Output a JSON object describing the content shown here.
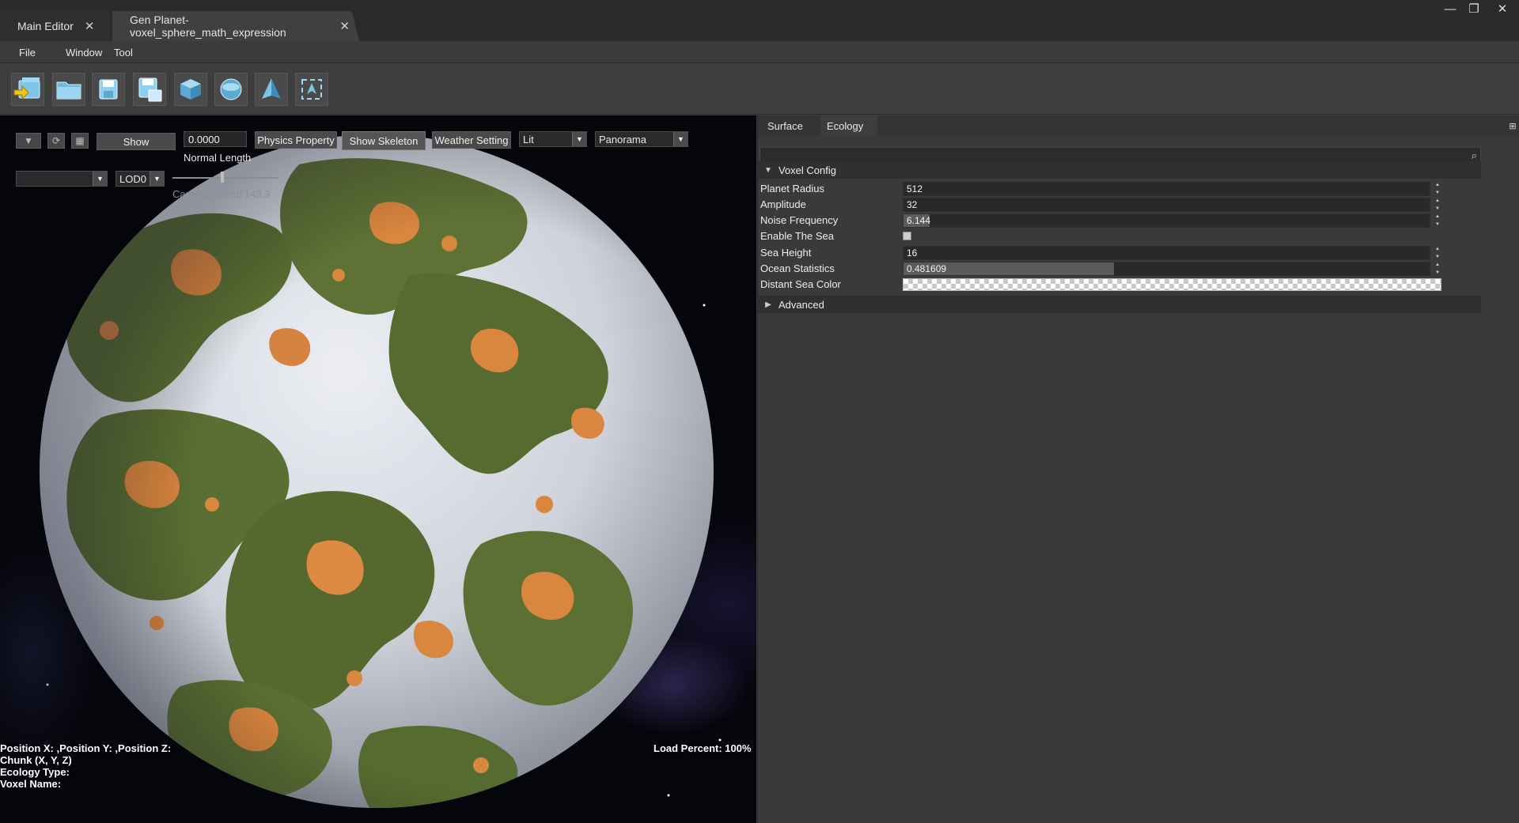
{
  "tabs": [
    {
      "label": "Main Editor"
    },
    {
      "label": "Gen Planet-voxel_sphere_math_expression"
    }
  ],
  "window_controls": {
    "minimize": "—",
    "restore": "❐",
    "close": "✕"
  },
  "menu": {
    "file": "File",
    "window": "Window",
    "tool": "Tool"
  },
  "toolbar": {
    "buttons": [
      "import-icon",
      "open-folder-icon",
      "save-icon",
      "save-as-icon",
      "cube-icon",
      "sphere-icon",
      "pyramid-icon",
      "fit-view-icon"
    ]
  },
  "viewport": {
    "show_button": "Show",
    "normal_length_value": "0.0000",
    "normal_length_label": "Normal Length",
    "physics_property_button": "Physics Property",
    "show_skeleton_button": "Show Skeleton",
    "weather_setting_button": "Weather Setting",
    "shading_mode": "Lit",
    "view_mode": "Panorama",
    "layer_select": "",
    "lod_select": "LOD0",
    "camera_speed_label": "Camera Speed 148.3",
    "camera_speed_fraction": 0.47,
    "status": {
      "position": "Position X: ,Position Y: ,Position Z:",
      "chunk": "Chunk (X, Y, Z)",
      "ecology": "Ecology Type:",
      "voxel": "Voxel Name:",
      "load": "Load Percent: 100%"
    },
    "colors": {
      "ocean": "#d8dbe2",
      "land_green": "#5a6f33",
      "land_orange": "#d9863f",
      "space": "#05060c"
    }
  },
  "panel": {
    "tabs": [
      "Surface",
      "Ecology"
    ],
    "search_placeholder": "",
    "voxel_config": {
      "title": "Voxel Config",
      "planet_radius_label": "Planet Radius",
      "planet_radius": "512",
      "amplitude_label": "Amplitude",
      "amplitude": "32",
      "noise_frequency_label": "Noise Frequency",
      "noise_frequency": "6.144",
      "noise_frequency_fill": 0.05,
      "enable_sea_label": "Enable The Sea",
      "enable_sea": false,
      "sea_height_label": "Sea Height",
      "sea_height": "16",
      "ocean_statistics_label": "Ocean Statistics",
      "ocean_statistics": "0.481609",
      "ocean_statistics_fill": 0.4,
      "distant_sea_color_label": "Distant Sea Color"
    },
    "advanced": {
      "title": "Advanced"
    }
  }
}
